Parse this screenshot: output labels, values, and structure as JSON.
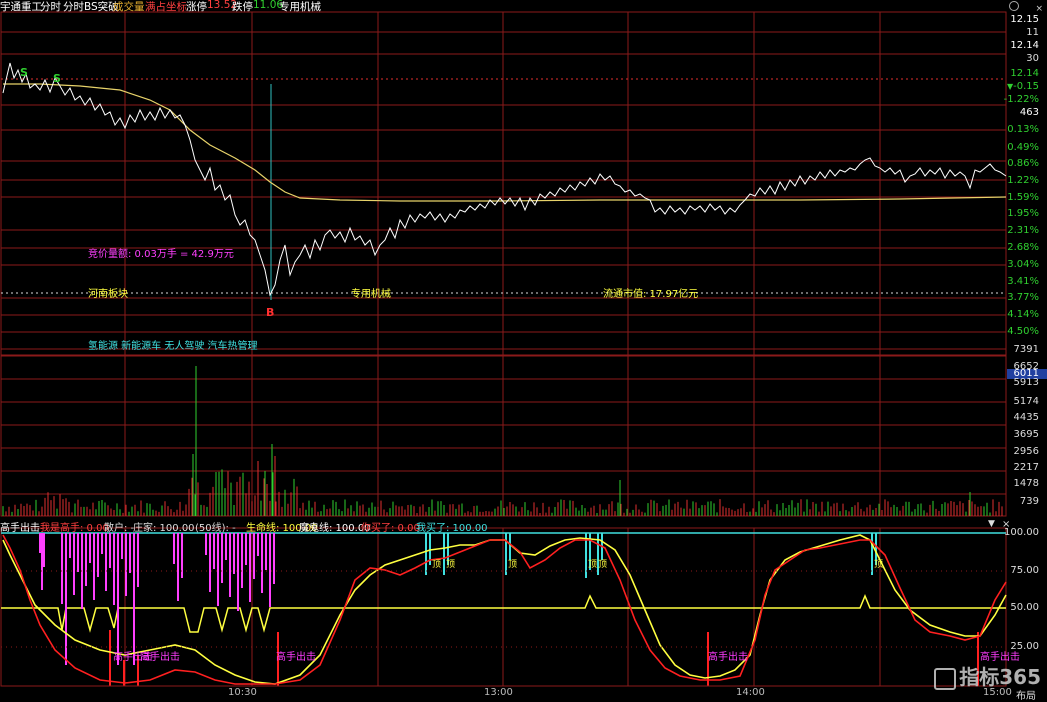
{
  "header": {
    "stock_name": "宇通重工",
    "tab_time": "分时",
    "tab_bs": "分时BS突破",
    "tab_volume": "成交量",
    "tab_fullscreen": "满占坐标",
    "limit_up_label": "涨停",
    "limit_up_value": "13.52",
    "limit_down_label": "跌停",
    "limit_down_value": "11.06",
    "sector": "专用机械"
  },
  "right_panel": {
    "price_top": "12.15",
    "v11": "11",
    "price_2": "12.14",
    "v30": "30",
    "price_3": "12.14",
    "change": "-0.15",
    "change_pct": "-1.22%",
    "count": "463",
    "pct_ticks": [
      "0.13%",
      "0.49%",
      "0.86%",
      "1.22%",
      "1.59%",
      "1.95%",
      "2.31%",
      "2.68%",
      "3.04%",
      "3.41%",
      "3.77%",
      "4.14%",
      "4.50%"
    ],
    "vol_ticks": [
      "7391",
      "6652",
      "6011",
      "5913",
      "5174",
      "4435",
      "3695",
      "2956",
      "2217",
      "1478",
      "739"
    ],
    "ind_ticks": [
      "100.00",
      "75.00",
      "50.00",
      "25.00"
    ]
  },
  "annotations": {
    "bid_volume": "竞价量额: 0.03万手 = 42.9万元",
    "region": "河南板块",
    "industry": "专用机械",
    "market_cap": "流通市值: 17.97亿元",
    "concepts": "氢能源 新能源车 无人驾驶 汽车热管理",
    "sell_marker_1": "S",
    "sell_marker_2": "S",
    "buy_marker": "B"
  },
  "indicator": {
    "name": "高手出击",
    "wo_shi": "我是高手: 0.00",
    "san_hu": "散户: -",
    "zhuang_jia": "庄家: 100.00",
    "line50": "(50线): -",
    "sheng_ming": "生命线: 100.00",
    "mo_gui": "魔鬼线: 100.00",
    "ni_mai": "你买了: 0.00",
    "wo_mai": "我买了: 100.00",
    "gao_shou_text": "高手出击",
    "ding_text": "顶"
  },
  "time_axis": [
    "10:30",
    "13:00",
    "14:00",
    "15:00"
  ],
  "bottom_right": "布局",
  "logo_text": "指标365",
  "colors": {
    "price_line": "#ffffff",
    "avg_line": "#e8d36a",
    "grid": "#8b1a1a",
    "volume": "#e03030",
    "volume_green": "#30d030",
    "yellow": "#ffff40",
    "red": "#ff2020",
    "magenta": "#ff40ff",
    "cyan": "#40e0e0"
  }
}
